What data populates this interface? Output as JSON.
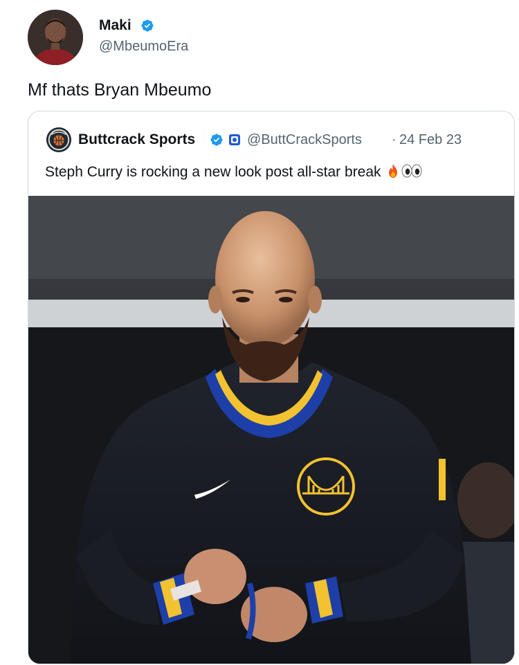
{
  "post": {
    "author": {
      "name": "Maki",
      "handle": "@MbeumoEra",
      "verified": true,
      "verified_color": "#1d9bf0"
    },
    "text": "Mf thats Bryan Mbeumo",
    "quoted": {
      "author_name": "Buttcrack Sports",
      "author_handle": "@ButtCrackSports",
      "separator": "·",
      "date": "24 Feb 23",
      "verified": true,
      "affiliate_badge_icon": "affiliate-badge-icon",
      "text": "Steph Curry is rocking a new look post all-star break",
      "emojis": [
        "fire-emoji",
        "eyes-emoji"
      ],
      "media": {
        "type": "photo",
        "subject": "player-in-warriors-warmup-jacket"
      }
    }
  },
  "colors": {
    "text_primary": "#0f1419",
    "text_secondary": "#536471",
    "border": "#cfd9de",
    "verified": "#1d9bf0"
  }
}
